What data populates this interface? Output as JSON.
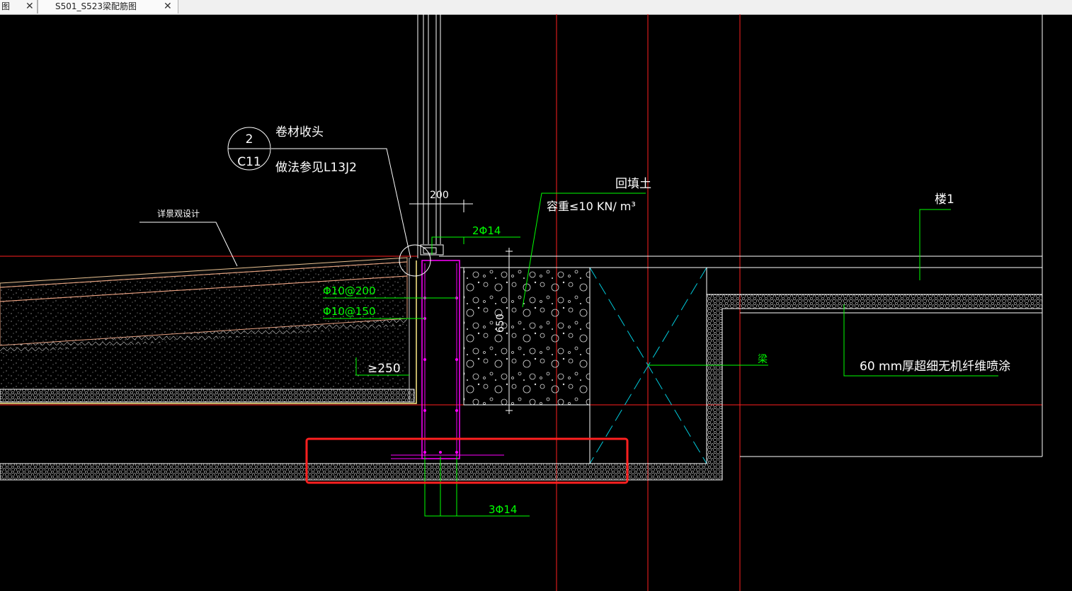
{
  "tabs": [
    {
      "label": "图",
      "close": "✕"
    },
    {
      "label": "S501_S523梁配筋图",
      "close": "✕"
    }
  ],
  "drawing": {
    "callout_top": "2",
    "callout_bottom": "C11",
    "note_membrane": "卷材收头",
    "note_method": "做法参见L13J2",
    "dim_200": "200",
    "landscape_note": "详景观设计",
    "rebar_2phi14": "2Φ14",
    "rebar_phi10_200": "Φ10@200",
    "rebar_phi10_150": "Φ10@150",
    "dim_650": "650",
    "dim_ge250": "≥250",
    "backfill_title": "回填土",
    "backfill_density": "容重≤10 KN/ m³",
    "building_label": "楼1",
    "beam_label": "梁",
    "spray_note": "60 mm厚超细无机纤维喷涂",
    "rebar_3phi14": "3Φ14"
  },
  "colors": {
    "background": "#000000",
    "red_line": "#ff2020",
    "green_text": "#00ff00",
    "white_line": "#ffffff",
    "cyan_dash": "#00ccdd",
    "magenta": "#ff00ff",
    "highlight_box": "#ff2020"
  }
}
